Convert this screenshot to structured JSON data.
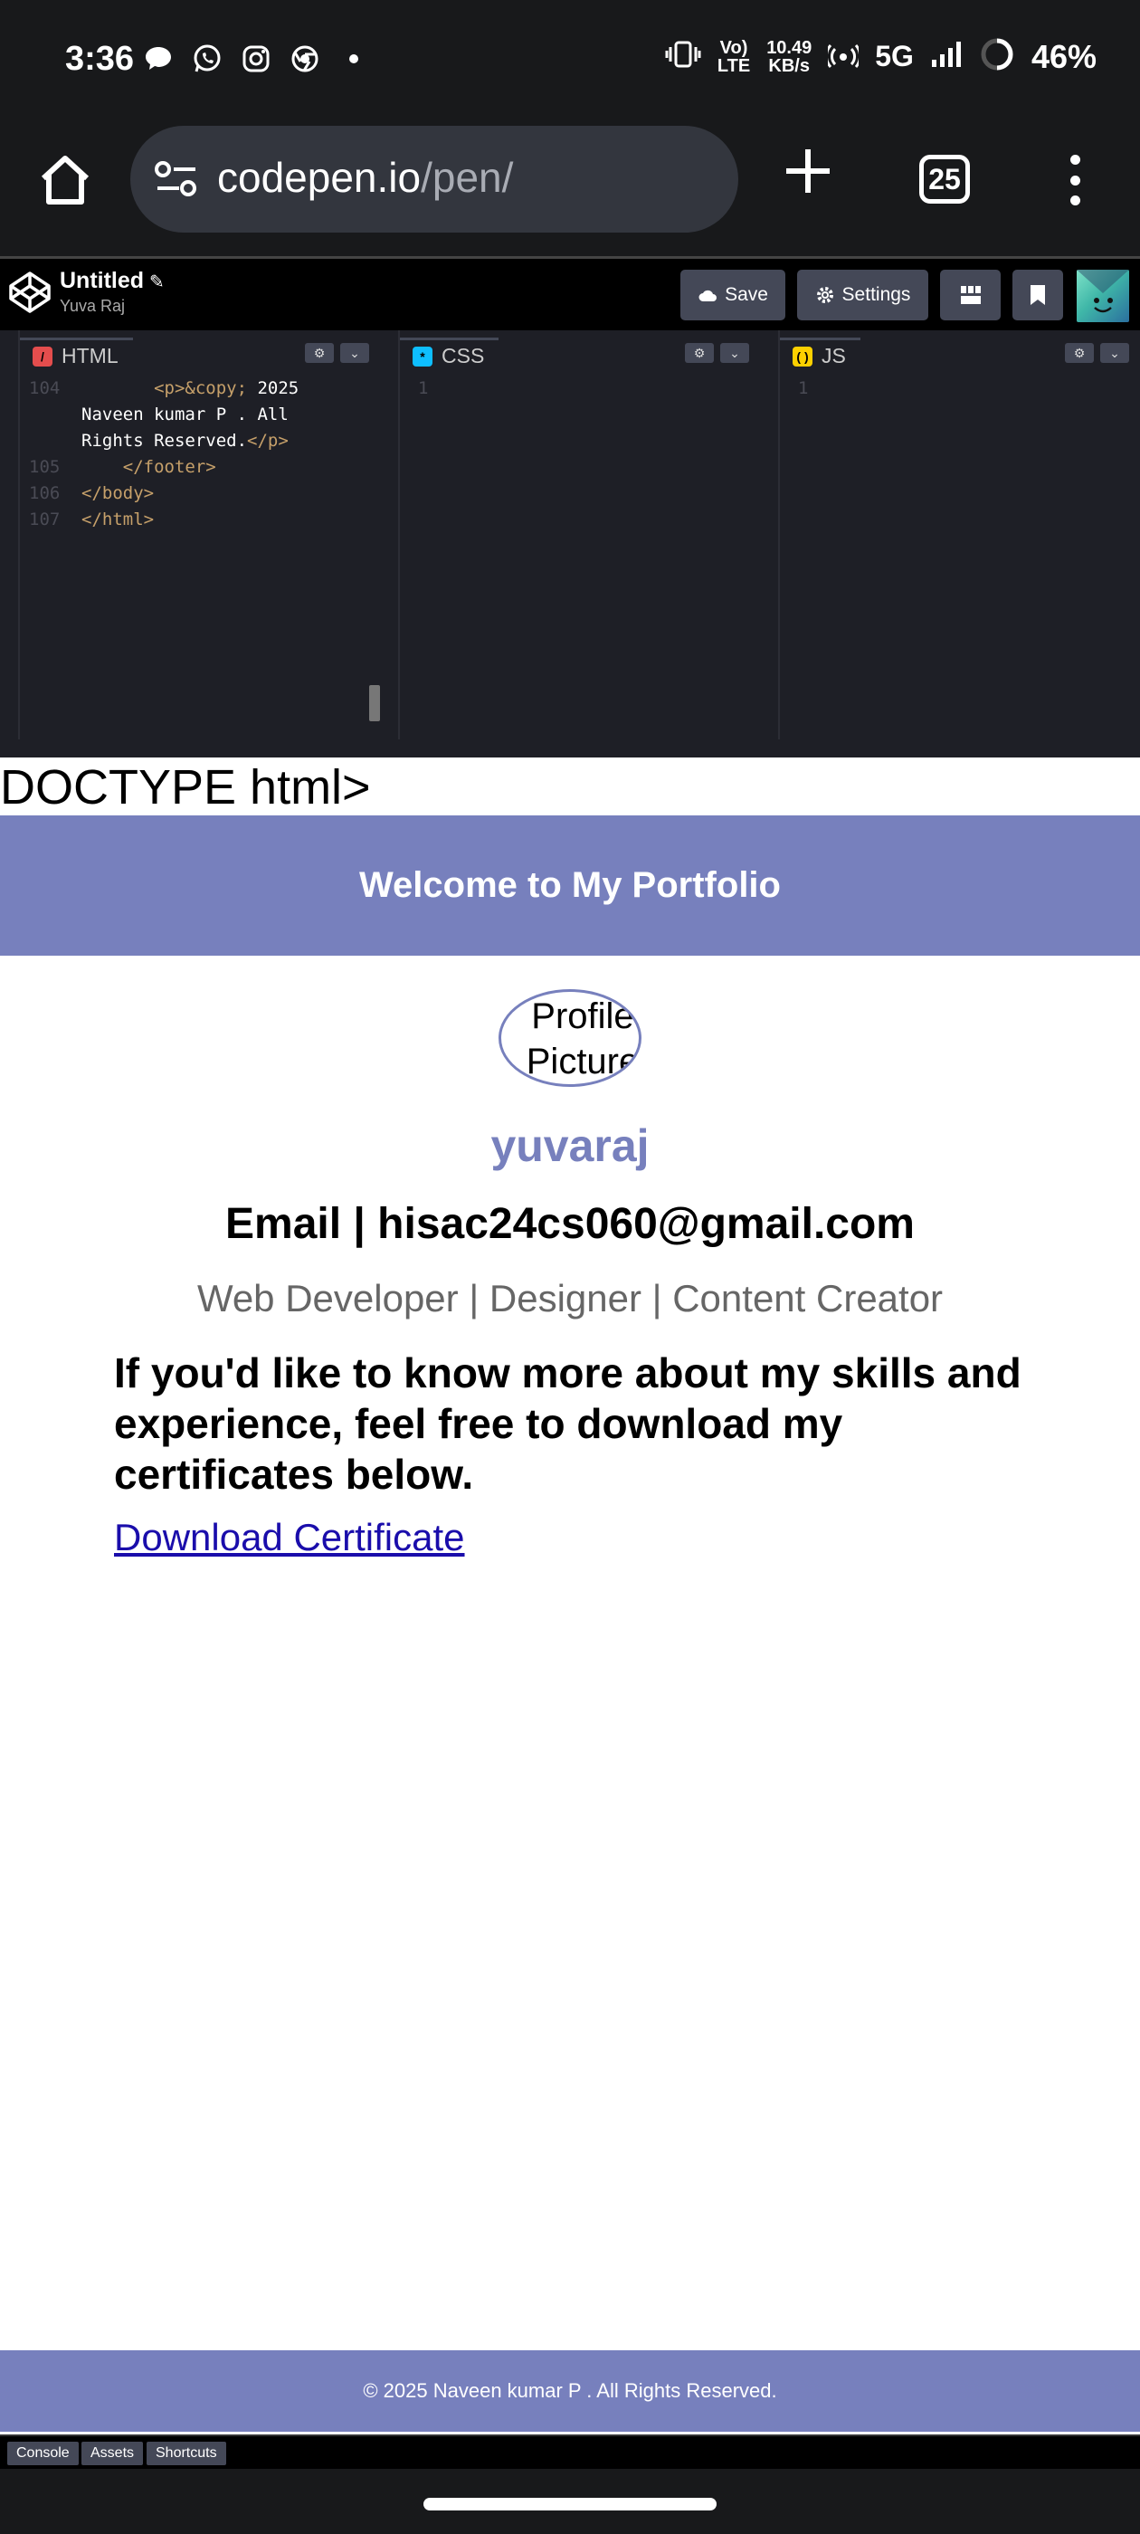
{
  "status_bar": {
    "time": "3:36",
    "net_line1": "Vo)",
    "net_line2": "LTE",
    "speed_line1": "10.49",
    "speed_line2": "KB/s",
    "network": "5G",
    "battery": "46%"
  },
  "browser": {
    "url_host": "codepen.io",
    "url_path": "/pen/",
    "tab_count": "25"
  },
  "codepen": {
    "title": "Untitled",
    "user": "Yuva Raj",
    "save_label": "Save",
    "settings_label": "Settings"
  },
  "editors": {
    "html_tab": "HTML",
    "css_tab": "CSS",
    "js_tab": "JS",
    "html_lines": [
      {
        "num": "104",
        "open": "<p>",
        "entity": "&copy;",
        "text": " 2025"
      },
      {
        "num": "",
        "text": "Naveen kumar P . All"
      },
      {
        "num": "",
        "text": "Rights Reserved.",
        "close": "</p>"
      },
      {
        "num": "105",
        "indent": "    ",
        "close": "</footer>"
      },
      {
        "num": "106",
        "close": "</body>"
      },
      {
        "num": "107",
        "close": "</html>"
      }
    ],
    "css_line": "1",
    "js_line": "1"
  },
  "preview": {
    "doctype_text": "DOCTYPE html>",
    "header": "Welcome to My Portfolio",
    "profile_alt": "Profile Picture",
    "name": "yuvaraj",
    "email": "Email | hisac24cs060@gmail.com",
    "role": "Web Developer | Designer | Content Creator",
    "blurb": "If you'd like to know more about my skills and experience, feel free to download my certificates below.",
    "link": "Download Certificate",
    "footer": "© 2025 Naveen kumar P . All Rights Reserved."
  },
  "bottom_bar": {
    "console": "Console",
    "assets": "Assets",
    "shortcuts": "Shortcuts"
  },
  "colors": {
    "accent": "#7780bd",
    "editor_bg": "#1e1f26",
    "html_icon": "#e44d4d",
    "css_icon": "#0ebeff",
    "js_icon": "#fcd000"
  }
}
